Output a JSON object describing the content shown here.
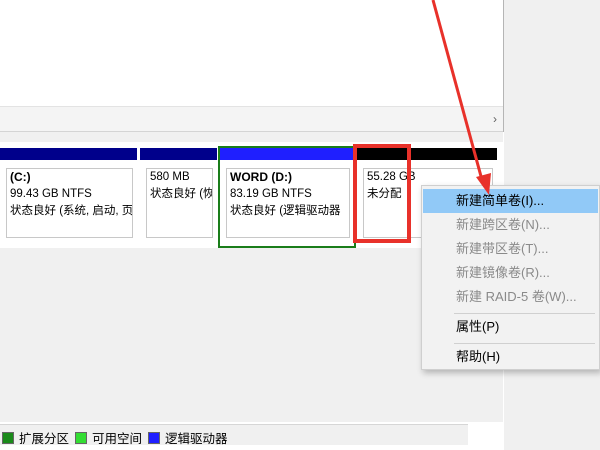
{
  "scrollbar": {
    "right_arrow": "›"
  },
  "partitions": [
    {
      "name": "(C:)",
      "size": "99.43 GB NTFS",
      "status": "状态良好 (系统, 启动, 页",
      "bar_color": "#00008b"
    },
    {
      "name": "",
      "size": "580 MB",
      "status": "状态良好 (恢",
      "bar_color": "#00008b"
    },
    {
      "name": "WORD  (D:)",
      "size": "83.19 GB NTFS",
      "status": "状态良好 (逻辑驱动器",
      "bar_color": "#1f1fff"
    },
    {
      "name": "",
      "size": "55.28 GB",
      "status": "未分配",
      "bar_color": "#000000"
    }
  ],
  "context_menu": {
    "items": [
      {
        "label": "新建简单卷(I)...",
        "state": "highlighted"
      },
      {
        "label": "新建跨区卷(N)...",
        "state": "disabled"
      },
      {
        "label": "新建带区卷(T)...",
        "state": "disabled"
      },
      {
        "label": "新建镜像卷(R)...",
        "state": "disabled"
      },
      {
        "label": "新建 RAID-5 卷(W)...",
        "state": "disabled"
      },
      {
        "label": "属性(P)",
        "state": "enabled"
      },
      {
        "label": "帮助(H)",
        "state": "enabled"
      }
    ]
  },
  "legend": [
    {
      "label": "扩展分区",
      "color": "#1a8a1a"
    },
    {
      "label": "可用空间",
      "color": "#33dd33"
    },
    {
      "label": "逻辑驱动器",
      "color": "#1f1fff"
    }
  ],
  "annotation": {
    "color": "#e8312a"
  }
}
